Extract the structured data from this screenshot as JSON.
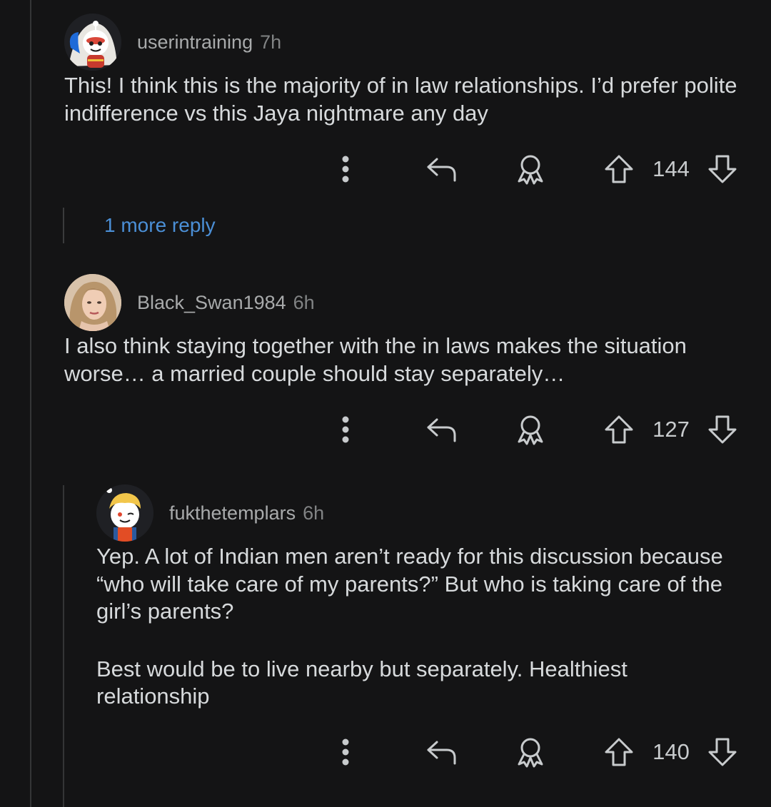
{
  "colors": {
    "background": "#141415",
    "text": "#d7dadc",
    "meta": "#818384",
    "link": "#4b8fd6",
    "icon": "#c8cbcd"
  },
  "comments": [
    {
      "username": "userintraining",
      "timestamp": "7h",
      "avatar": "snoo-avatar-ninja",
      "paragraphs": [
        "This! I think this is the majority of in law relationships. I’d prefer polite indifference vs this Jaya nightmare any day"
      ],
      "score": "144"
    },
    {
      "username": "Black_Swan1984",
      "timestamp": "6h",
      "avatar": "photo-avatar",
      "paragraphs": [
        "I also think staying together with the in laws makes the situation worse… a married couple should stay separately…"
      ],
      "score": "127"
    },
    {
      "username": "fukthetemplars",
      "timestamp": "6h",
      "avatar": "snoo-avatar-blond",
      "paragraphs": [
        "Yep. A lot of Indian men aren’t ready for this discussion because “who will take care of my parents?” But who is taking care of the girl’s parents?",
        "Best would be to live nearby but separately. Healthiest relationship"
      ],
      "score": "140"
    }
  ],
  "more_replies": {
    "label": "1 more reply"
  },
  "icons": {
    "more": "more-vertical-icon",
    "reply": "reply-arrow-icon",
    "award": "award-icon",
    "upvote": "upvote-arrow-icon",
    "downvote": "downvote-arrow-icon"
  }
}
